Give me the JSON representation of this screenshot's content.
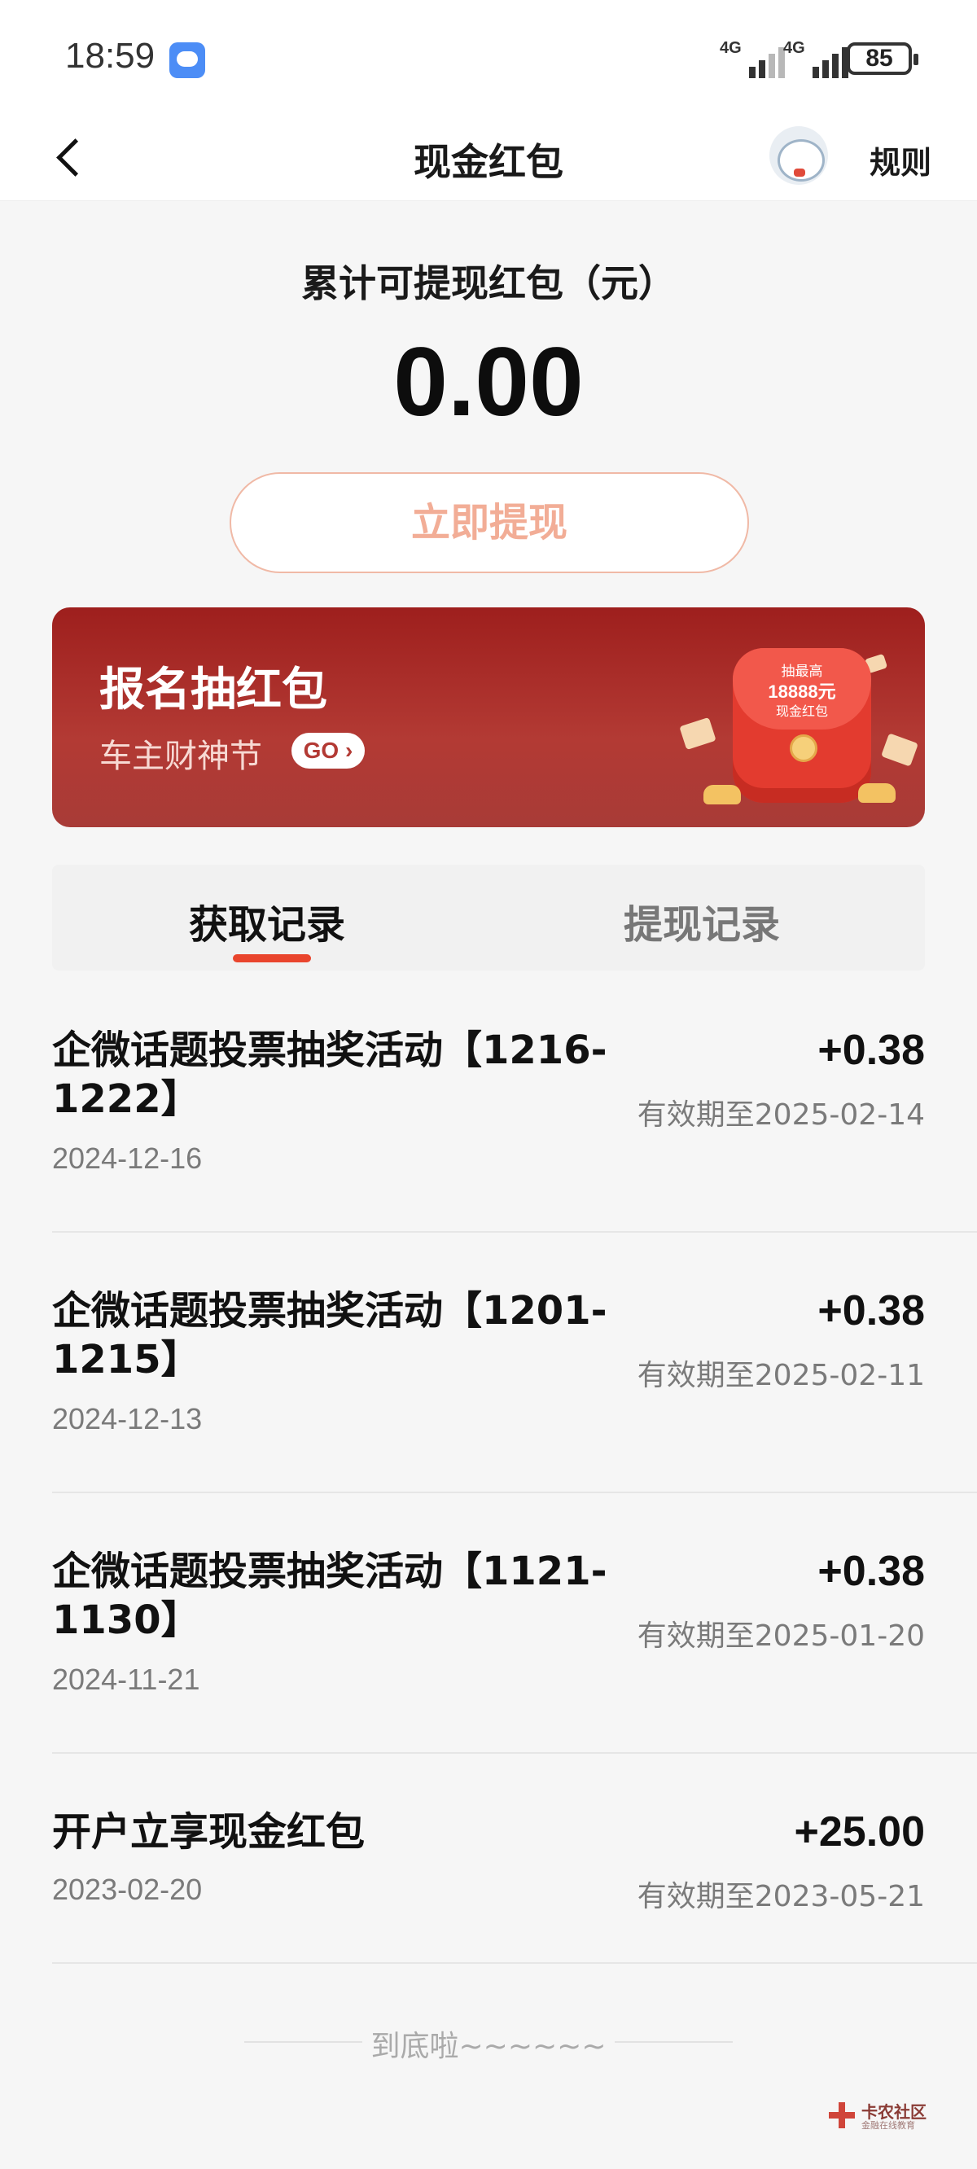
{
  "status_bar": {
    "time": "18:59",
    "signal_label_1": "4G",
    "signal_label_2": "4G",
    "battery": "85"
  },
  "nav": {
    "title": "现金红包",
    "rule_label": "规则"
  },
  "summary": {
    "label": "累计可提现红包（元）",
    "amount": "0.00",
    "withdraw_button": "立即提现"
  },
  "banner": {
    "title": "报名抽红包",
    "subtitle": "车主财神节",
    "go_label": "GO",
    "envelope_line1": "抽最高",
    "envelope_line2": "18888元",
    "envelope_line3": "现金红包"
  },
  "tabs": [
    {
      "label": "获取记录",
      "active": true
    },
    {
      "label": "提现记录",
      "active": false
    }
  ],
  "records": [
    {
      "title": "企微话题投票抽奖活动【1216-1222】",
      "date": "2024-12-16",
      "amount": "+0.38",
      "expiry": "有效期至2025-02-14"
    },
    {
      "title": "企微话题投票抽奖活动【1201-1215】",
      "date": "2024-12-13",
      "amount": "+0.38",
      "expiry": "有效期至2025-02-11"
    },
    {
      "title": "企微话题投票抽奖活动【1121-1130】",
      "date": "2024-11-21",
      "amount": "+0.38",
      "expiry": "有效期至2025-01-20"
    },
    {
      "title": "开户立享现金红包",
      "date": "2023-02-20",
      "amount": "+25.00",
      "expiry": "有效期至2023-05-21"
    }
  ],
  "end_text": "到底啦~~~~~~",
  "watermark": {
    "name": "卡农社区",
    "tagline": "金融在线教育"
  },
  "colors": {
    "accent": "#e9452d",
    "banner": "#b33a34",
    "button_text": "#f2ad96"
  }
}
